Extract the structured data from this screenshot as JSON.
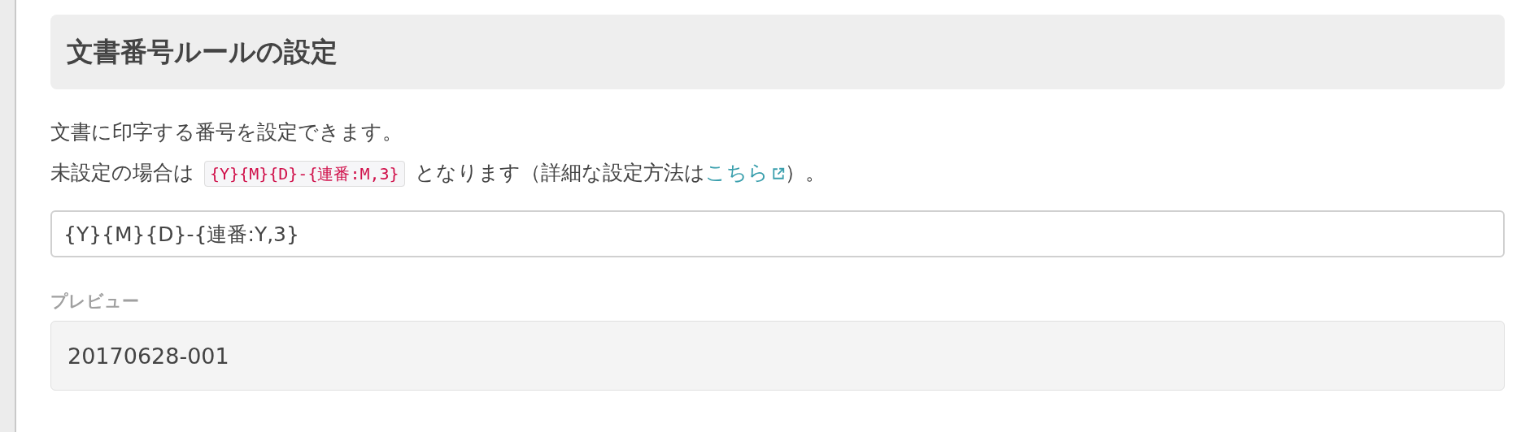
{
  "panel": {
    "title": "文書番号ルールの設定"
  },
  "description": {
    "line_1": "文書に印字する番号を設定できます。",
    "line_2": {
      "before": "未設定の場合は",
      "code": "{Y}{M}{D}-{連番:M,3}",
      "middle": "となります（詳細な設定方法は",
      "link": "こちら",
      "after": "）。"
    }
  },
  "rule_field": {
    "value": "{Y}{M}{D}-{連番:Y,3}"
  },
  "preview": {
    "label": "プレビュー",
    "value": "20170628-001"
  }
}
